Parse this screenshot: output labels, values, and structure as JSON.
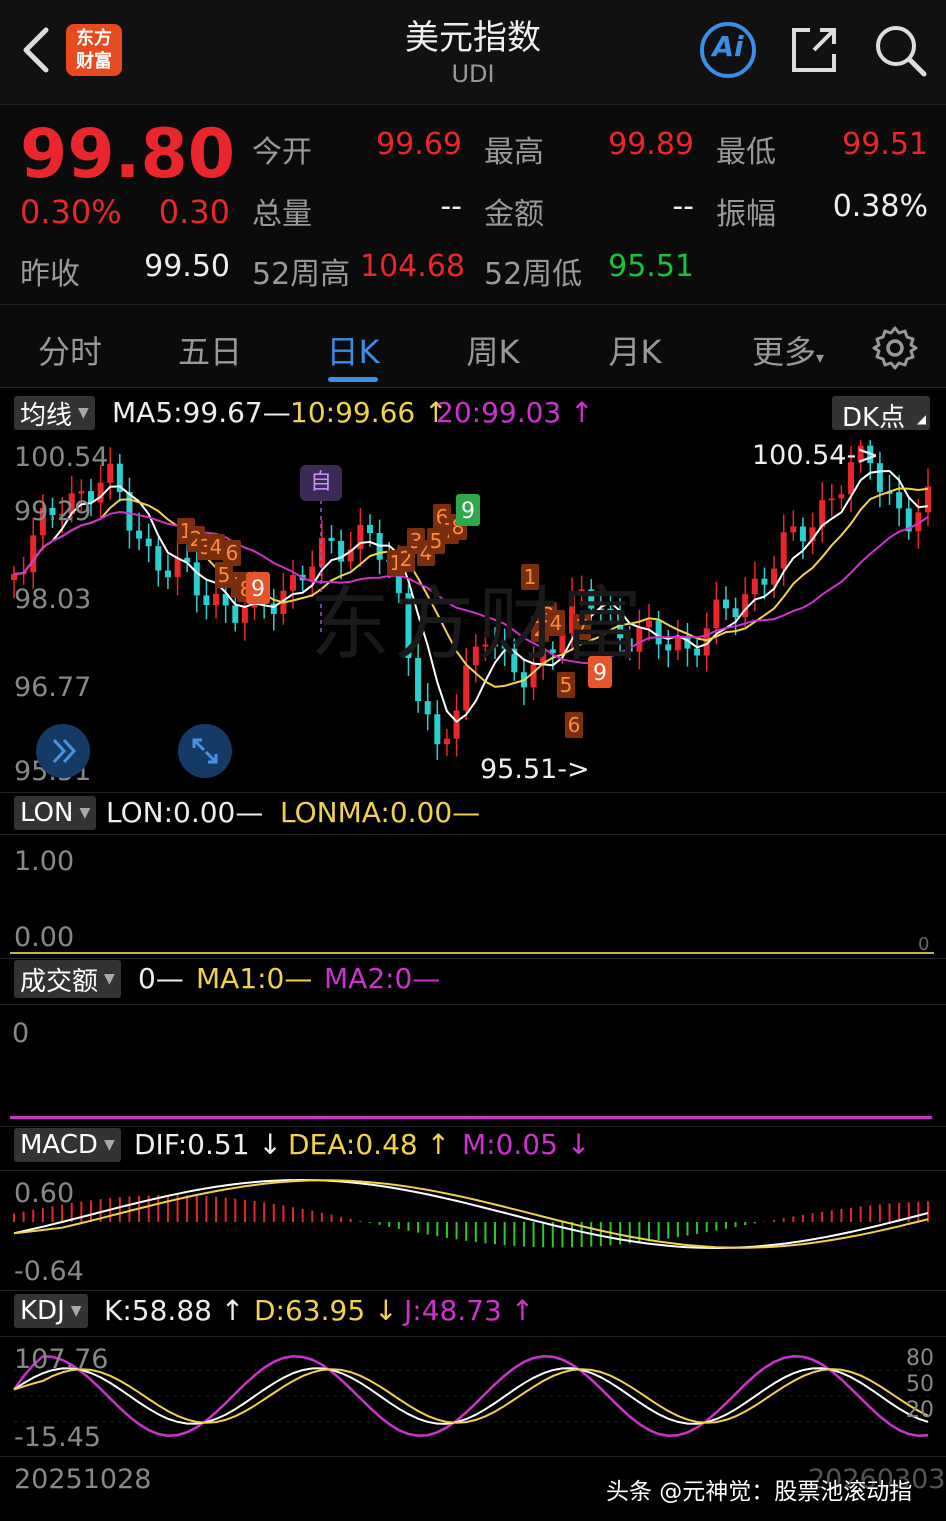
{
  "header": {
    "title": "美元指数",
    "code": "UDI",
    "logo_text_line1": "东方",
    "logo_text_line2": "财富",
    "ai_label": "Ai"
  },
  "quote": {
    "price": "99.80",
    "change_pct": "0.30%",
    "change": "0.30",
    "open_label": "今开",
    "open": "99.69",
    "high_label": "最高",
    "high": "99.89",
    "low_label": "最低",
    "low": "99.51",
    "volume_label": "总量",
    "volume": "--",
    "amount_label": "金额",
    "amount": "--",
    "amplitude_label": "振幅",
    "amplitude": "0.38%",
    "prev_close_label": "昨收",
    "prev_close": "99.50",
    "wk52_high_label": "52周高",
    "wk52_high": "104.68",
    "wk52_low_label": "52周低",
    "wk52_low": "95.51"
  },
  "tabs": [
    "分时",
    "五日",
    "日K",
    "周K",
    "月K",
    "更多"
  ],
  "active_tab": "日K",
  "main_chart": {
    "indicator_select": "均线",
    "ma5": "MA5:99.67—",
    "ma10": "10:99.66",
    "ma20": "20:99.03",
    "dk_label": "DK点",
    "y_ticks": [
      "100.54",
      "99.29",
      "98.03",
      "96.77",
      "95.51"
    ],
    "high_marker": "100.54->",
    "low_marker": "95.51->",
    "self_marker": "自",
    "nine_label": "9",
    "seq_label_a": "1",
    "seq_label_b": "2",
    "seq_label_c": "3",
    "seq_label_d": "4",
    "seq_label_e": "5",
    "seq_label_f": "6",
    "seq_label_g": "7",
    "seq_label_h": "8",
    "watermark": "东方财富"
  },
  "lon_panel": {
    "indicator_select": "LON",
    "lon": "LON:0.00—",
    "lonma": "LONMA:0.00—",
    "y_top": "1.00",
    "y_bottom": "0.00",
    "right_zero": "0"
  },
  "amount_panel": {
    "indicator_select": "成交额",
    "value": "0—",
    "ma1": "MA1:0—",
    "ma2": "MA2:0—",
    "y_tick": "0"
  },
  "macd_panel": {
    "indicator_select": "MACD",
    "dif": "DIF:0.51",
    "dea": "DEA:0.48",
    "m": "M:0.05",
    "y_top": "0.60",
    "y_bottom": "-0.64"
  },
  "kdj_panel": {
    "indicator_select": "KDJ",
    "k": "K:58.88",
    "d": "D:63.95",
    "j": "J:48.73",
    "y_top": "107.76",
    "y_bottom": "-15.45",
    "r80": "80",
    "r50": "50",
    "r20": "20"
  },
  "footer": {
    "start_date": "20251028",
    "end_date": "20260303",
    "watermark": "头条 @元神觉：股票池滚动指"
  },
  "colors": {
    "up": "#e8262b",
    "down": "#2ad0d0",
    "ma5": "#ffffff",
    "ma10": "#f0d24b",
    "ma20": "#cc33cc",
    "accent": "#3a8ee6"
  }
}
